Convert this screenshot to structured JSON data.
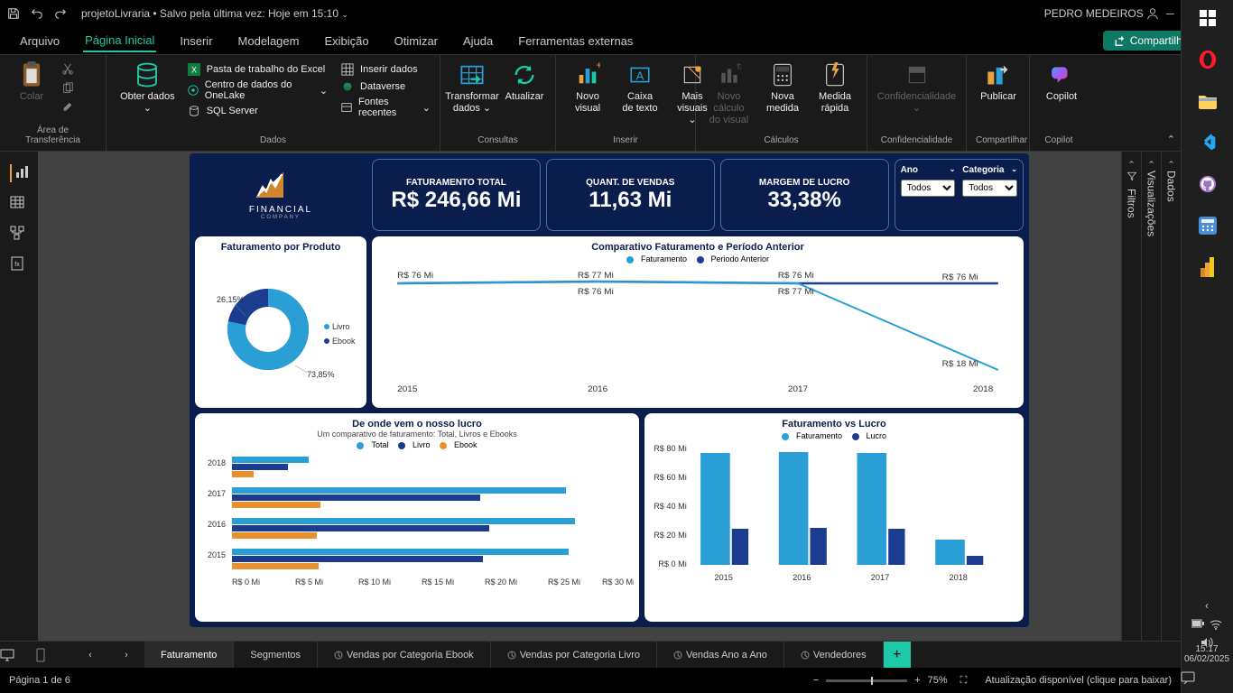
{
  "titlebar": {
    "filename": "projetoLivraria",
    "saved": "Salvo pela última vez: Hoje em 15:10",
    "user": "PEDRO MEDEIROS"
  },
  "menubar": {
    "tabs": [
      "Arquivo",
      "Página Inicial",
      "Inserir",
      "Modelagem",
      "Exibição",
      "Otimizar",
      "Ajuda",
      "Ferramentas externas"
    ],
    "active": 1,
    "share": "Compartilhar"
  },
  "ribbon": {
    "clipboard": {
      "label": "Área de Transferência",
      "paste": "Colar"
    },
    "data": {
      "label": "Dados",
      "get": "Obter dados",
      "excel": "Pasta de trabalho do Excel",
      "onelake": "Centro de dados do OneLake",
      "sql": "SQL Server",
      "insert": "Inserir dados",
      "dataverse": "Dataverse",
      "recent": "Fontes recentes"
    },
    "queries": {
      "label": "Consultas",
      "transform": "Transformar dados",
      "refresh": "Atualizar"
    },
    "insert": {
      "label": "Inserir",
      "visual": "Novo visual",
      "textbox": "Caixa de texto",
      "more": "Mais visuais"
    },
    "calc": {
      "label": "Cálculos",
      "newcalc": "Novo cálculo do visual",
      "measure": "Nova medida",
      "quick": "Medida rápida"
    },
    "sens": {
      "label": "Confidencialidade",
      "btn": "Confidencialidade"
    },
    "share": {
      "label": "Compartilhar",
      "btn": "Publicar"
    },
    "copilot": {
      "label": "Copilot",
      "btn": "Copilot"
    }
  },
  "panes": {
    "filters": "Filtros",
    "viz": "Visualizações",
    "data": "Dados"
  },
  "dashboard": {
    "logo": {
      "line1": "FINANCIAL",
      "line2": "COMPANY"
    },
    "kpi1": {
      "title": "FATURAMENTO TOTAL",
      "value": "R$ 246,66 Mi"
    },
    "kpi2": {
      "title": "QUANT. DE VENDAS",
      "value": "11,63 Mi"
    },
    "kpi3": {
      "title": "MARGEM DE LUCRO",
      "value": "33,38%"
    },
    "slicer1": {
      "label": "Ano",
      "value": "Todos"
    },
    "slicer2": {
      "label": "Categoria",
      "value": "Todos"
    },
    "donut": {
      "title": "Faturamento por Produto",
      "legend": [
        "Livro",
        "Ebook"
      ],
      "labels": [
        "26,15%",
        "73,85%"
      ]
    },
    "line": {
      "title": "Comparativo Faturamento e Período Anterior",
      "legend": [
        "Faturamento",
        "Periodo Anterior"
      ],
      "datalabels": [
        "R$ 76 Mi",
        "R$ 77 Mi",
        "R$ 76 Mi",
        "R$ 76 Mi",
        "R$ 77 Mi",
        "R$ 76 Mi",
        "R$ 18 Mi"
      ],
      "xaxis": [
        "2015",
        "2016",
        "2017",
        "2018"
      ]
    },
    "bars": {
      "title": "De onde vem o nosso lucro",
      "sub": "Um comparativo de faturamento: Total, Livros e Ebooks",
      "legend": [
        "Total",
        "Livro",
        "Ebook"
      ],
      "yaxis": [
        "2018",
        "2017",
        "2016",
        "2015"
      ],
      "xaxis": [
        "R$ 0 Mi",
        "R$ 5 Mi",
        "R$ 10 Mi",
        "R$ 15 Mi",
        "R$ 20 Mi",
        "R$ 25 Mi",
        "R$ 30 Mi"
      ]
    },
    "cols": {
      "title": "Faturamento vs Lucro",
      "legend": [
        "Faturamento",
        "Lucro"
      ],
      "yaxis": [
        "R$ 80 Mi",
        "R$ 60 Mi",
        "R$ 40 Mi",
        "R$ 20 Mi",
        "R$ 0 Mi"
      ],
      "xaxis": [
        "2015",
        "2016",
        "2017",
        "2018"
      ]
    }
  },
  "pages": {
    "tabs": [
      "Faturamento",
      "Segmentos",
      "Vendas por Categoria Ebook",
      "Vendas por Categoria Livro",
      "Vendas Ano a Ano",
      "Vendedores"
    ],
    "active": 0
  },
  "status": {
    "page": "Página 1 de 6",
    "zoom": "75%",
    "update": "Atualização disponível (clique para baixar)"
  },
  "clock": {
    "time": "15:17",
    "date": "06/02/2025"
  },
  "chart_data": [
    {
      "type": "pie",
      "title": "Faturamento por Produto",
      "series": [
        {
          "name": "Livro",
          "value": 73.85
        },
        {
          "name": "Ebook",
          "value": 26.15
        }
      ]
    },
    {
      "type": "line",
      "title": "Comparativo Faturamento e Período Anterior",
      "x": [
        2015,
        2016,
        2017,
        2018
      ],
      "series": [
        {
          "name": "Faturamento",
          "values": [
            76,
            77,
            76,
            18
          ],
          "unit": "R$ Mi"
        },
        {
          "name": "Periodo Anterior",
          "values": [
            76,
            76,
            77,
            76
          ],
          "unit": "R$ Mi"
        }
      ]
    },
    {
      "type": "bar",
      "title": "De onde vem o nosso lucro",
      "orientation": "horizontal",
      "categories": [
        "2018",
        "2017",
        "2016",
        "2015"
      ],
      "series": [
        {
          "name": "Total",
          "values": [
            6,
            26,
            27,
            26
          ],
          "unit": "R$ Mi"
        },
        {
          "name": "Livro",
          "values": [
            4,
            19,
            20,
            19
          ],
          "unit": "R$ Mi"
        },
        {
          "name": "Ebook",
          "values": [
            2,
            7,
            6.8,
            6.8
          ],
          "unit": "R$ Mi"
        }
      ],
      "xlim": [
        0,
        30
      ]
    },
    {
      "type": "bar",
      "title": "Faturamento vs Lucro",
      "categories": [
        "2015",
        "2016",
        "2017",
        "2018"
      ],
      "series": [
        {
          "name": "Faturamento",
          "values": [
            76,
            77,
            76,
            18
          ],
          "unit": "R$ Mi"
        },
        {
          "name": "Lucro",
          "values": [
            25,
            26,
            25,
            6
          ],
          "unit": "R$ Mi"
        }
      ],
      "ylim": [
        0,
        80
      ]
    }
  ]
}
